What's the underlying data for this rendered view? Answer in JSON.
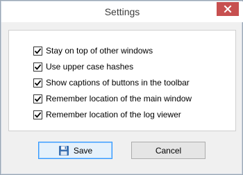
{
  "window": {
    "title": "Settings"
  },
  "titlebar": {
    "close_icon": "close-x",
    "close_color": "#c75050"
  },
  "options": [
    {
      "label": "Stay on top of other windows",
      "checked": true
    },
    {
      "label": "Use upper case hashes",
      "checked": true
    },
    {
      "label": "Show captions of buttons in the toolbar",
      "checked": true
    },
    {
      "label": "Remember location of the main window",
      "checked": true
    },
    {
      "label": "Remember location of the log viewer",
      "checked": true
    }
  ],
  "buttons": {
    "save_label": "Save",
    "save_icon": "floppy-disk",
    "cancel_label": "Cancel"
  }
}
